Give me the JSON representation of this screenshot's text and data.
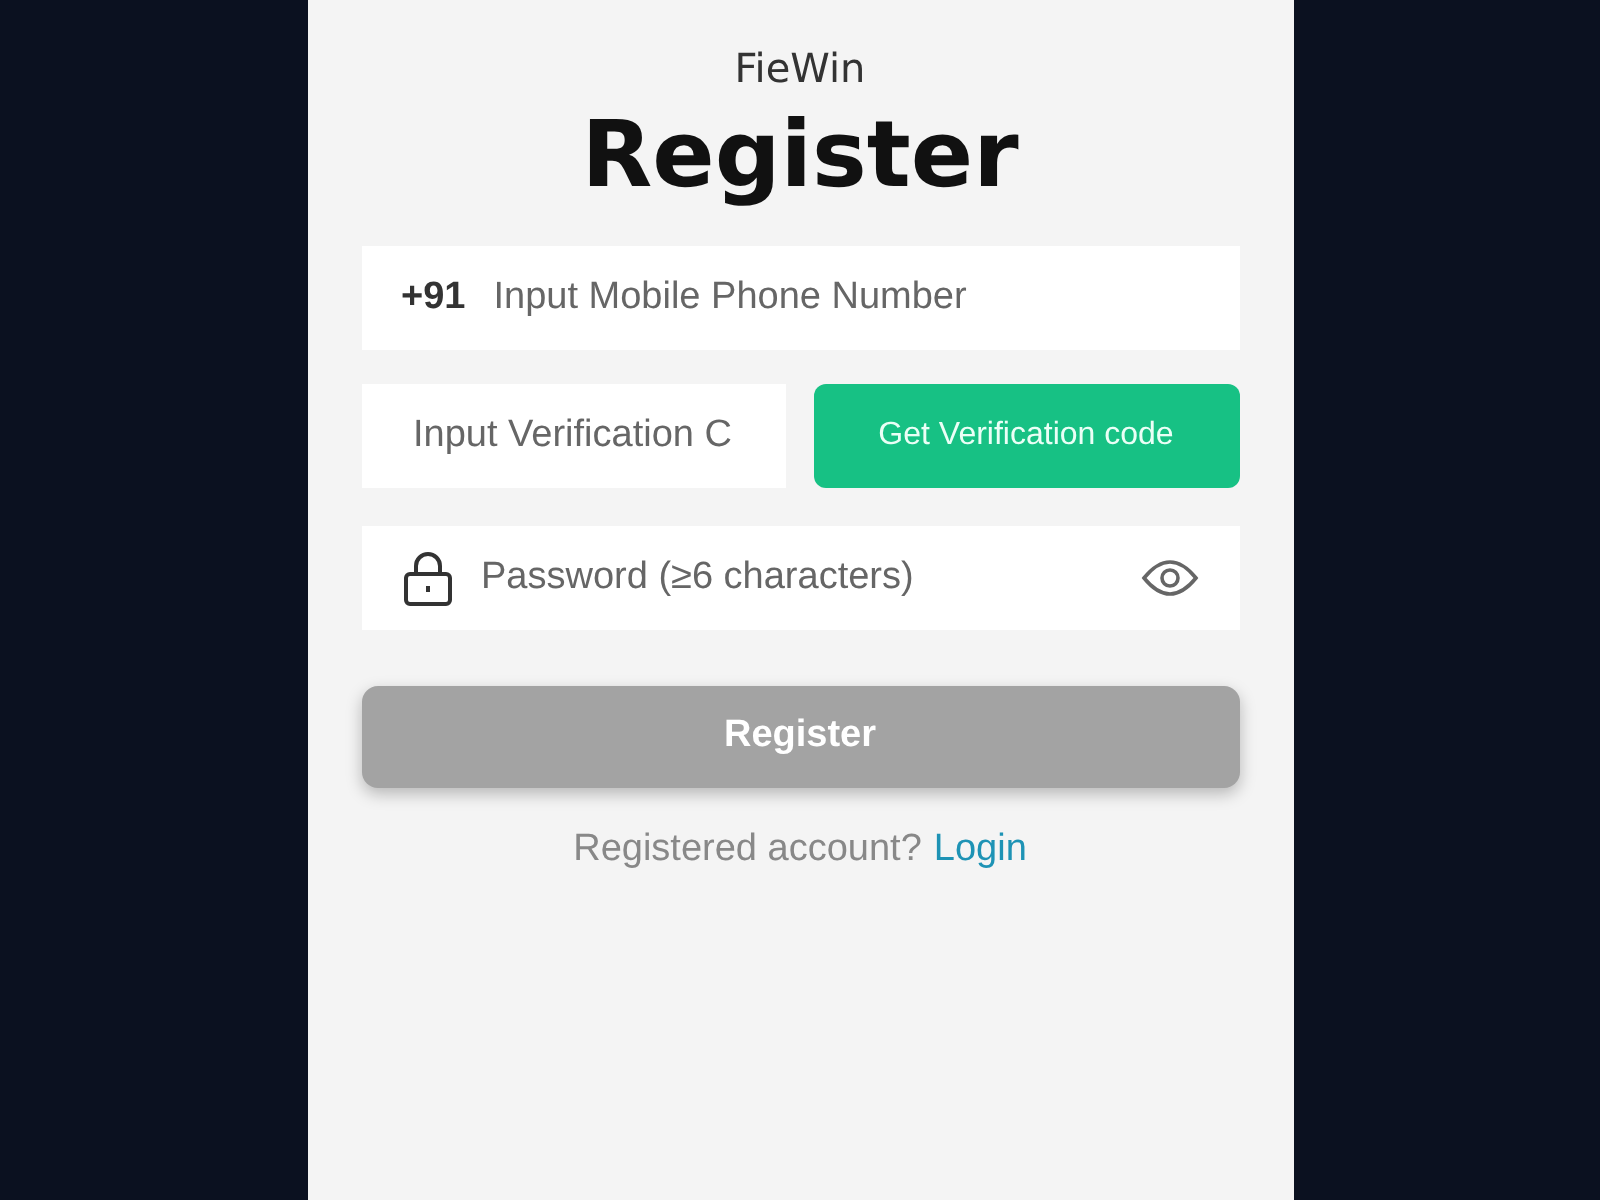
{
  "brand": "FieWin",
  "title": "Register",
  "phone": {
    "prefix": "+91",
    "placeholder": "Input Mobile Phone Number"
  },
  "code": {
    "placeholder": "Input Verification C",
    "button": "Get Verification code"
  },
  "password": {
    "placeholder": "Password (≥6 characters)"
  },
  "submit": {
    "label": "Register",
    "disabled": true
  },
  "footer": {
    "text": "Registered account?",
    "link": "Login"
  }
}
